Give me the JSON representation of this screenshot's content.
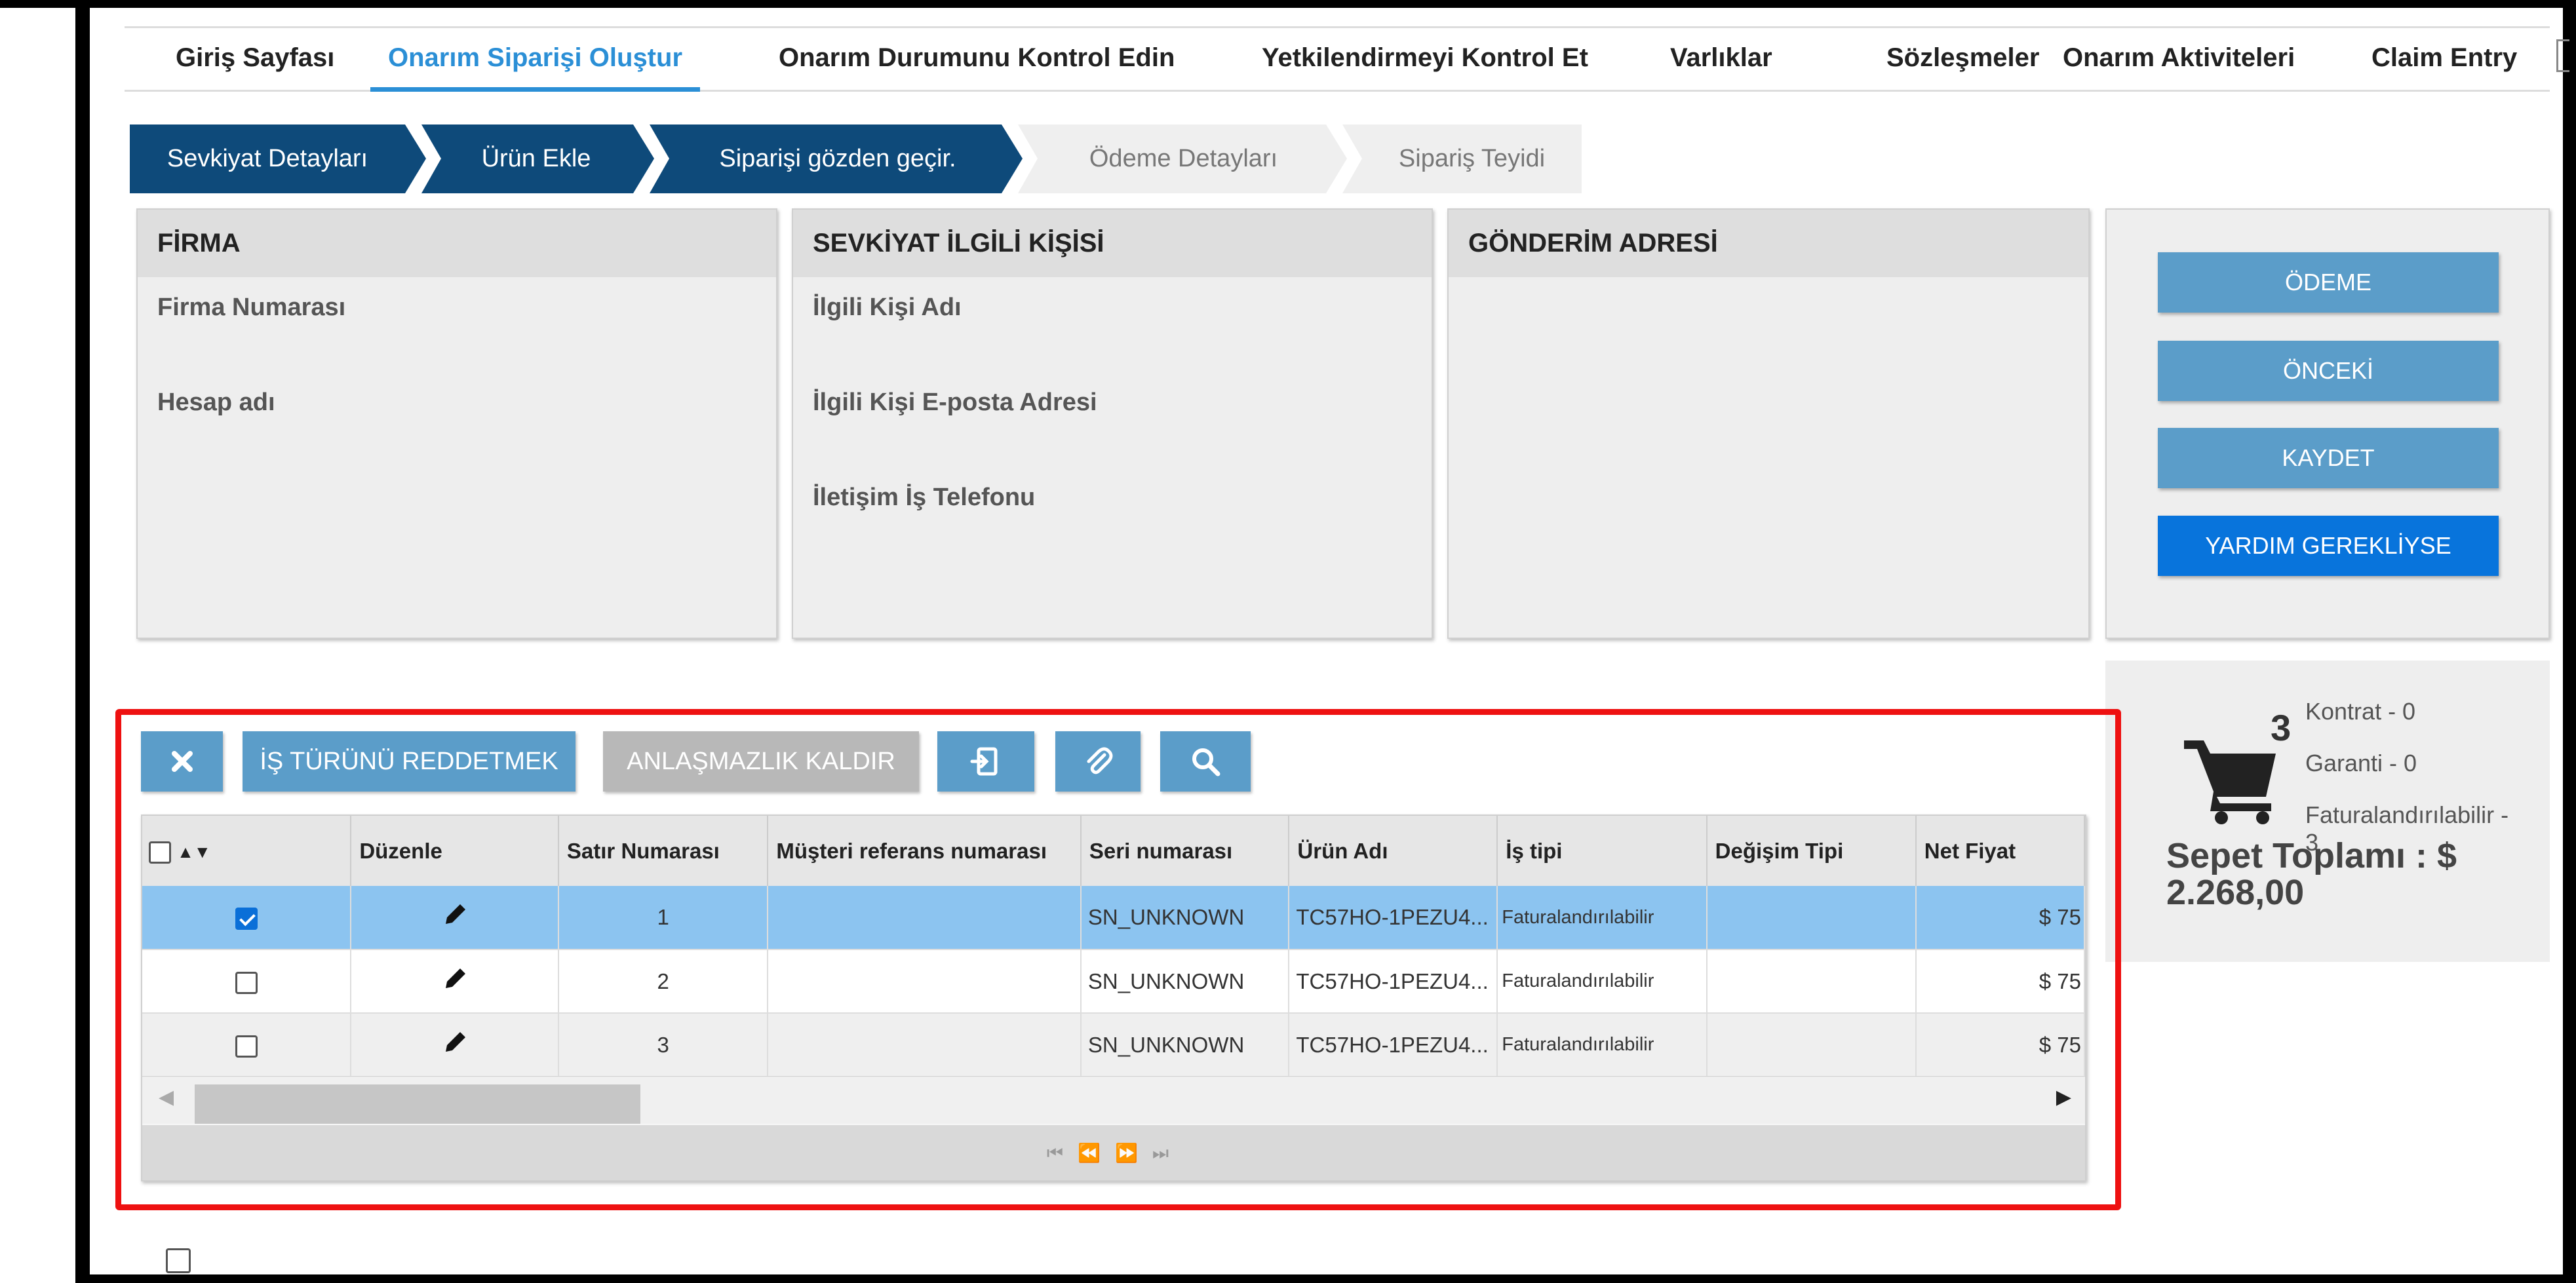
{
  "nav": {
    "items": [
      {
        "label": "Giriş Sayfası",
        "active": false
      },
      {
        "label": "Onarım Siparişi Oluştur",
        "active": true
      },
      {
        "label": "Onarım Durumunu Kontrol Edin",
        "active": false
      },
      {
        "label": "Yetkilendirmeyi Kontrol Et",
        "active": false
      },
      {
        "label": "Varlıklar",
        "active": false
      },
      {
        "label": "Sözleşmeler",
        "active": false
      },
      {
        "label": "Onarım Aktiviteleri",
        "active": false
      },
      {
        "label": "Claim Entry",
        "active": false
      }
    ]
  },
  "steps": [
    {
      "label": "Sevkiyat Detayları",
      "state": "done"
    },
    {
      "label": "Ürün Ekle",
      "state": "done"
    },
    {
      "label": "Siparişi gözden geçir.",
      "state": "done"
    },
    {
      "label": "Ödeme Detayları",
      "state": "todo"
    },
    {
      "label": "Sipariş Teyidi",
      "state": "todo"
    }
  ],
  "panels": {
    "firma": {
      "title": "FİRMA",
      "fields": [
        "Firma Numarası",
        "Hesap adı"
      ]
    },
    "contact": {
      "title": "SEVKİYAT İLGİLİ KİŞİSİ",
      "fields": [
        "İlgili Kişi Adı",
        "İlgili Kişi E-posta Adresi",
        "İletişim İş Telefonu"
      ]
    },
    "address": {
      "title": "GÖNDERİM ADRESİ"
    }
  },
  "actions": {
    "payment": "ÖDEME",
    "previous": "ÖNCEKİ",
    "save": "KAYDET",
    "help": "YARDIM GEREKLİYSE"
  },
  "cart": {
    "count": "3",
    "contract": "Kontrat - 0",
    "warranty": "Garanti - 0",
    "billable": "Faturalandırılabilir -",
    "billable_count": "3",
    "total": "Sepet Toplamı : $ 2.268,00"
  },
  "toolbar": {
    "reject_label": "İŞ TÜRÜNÜ REDDETMEK",
    "dispute_label": "ANLAŞMAZLIK KALDIR"
  },
  "grid": {
    "columns": [
      "Düzenle",
      "Satır Numarası",
      "Müşteri referans numarası",
      "Seri numarası",
      "Ürün Adı",
      "İş tipi",
      "Değişim Tipi",
      "Net Fiyat"
    ],
    "rows": [
      {
        "checked": true,
        "line": "1",
        "customer_ref": "",
        "serial": "SN_UNKNOWN",
        "product": "TC57HO-1PEZU4...",
        "work_type": "Faturalandırılabilir",
        "change_type": "",
        "net_price": "$ 75"
      },
      {
        "checked": false,
        "line": "2",
        "customer_ref": "",
        "serial": "SN_UNKNOWN",
        "product": "TC57HO-1PEZU4...",
        "work_type": "Faturalandırılabilir",
        "change_type": "",
        "net_price": "$ 75"
      },
      {
        "checked": false,
        "line": "3",
        "customer_ref": "",
        "serial": "SN_UNKNOWN",
        "product": "TC57HO-1PEZU4...",
        "work_type": "Faturalandırılabilir",
        "change_type": "",
        "net_price": "$ 75"
      }
    ]
  },
  "colors": {
    "nav_active": "#2b8fd6",
    "step_done": "#0e4a7a",
    "button": "#5b9dc9",
    "button_primary": "#0874dc",
    "selected_row": "#8cc4f0",
    "highlight": "#ee1111"
  }
}
